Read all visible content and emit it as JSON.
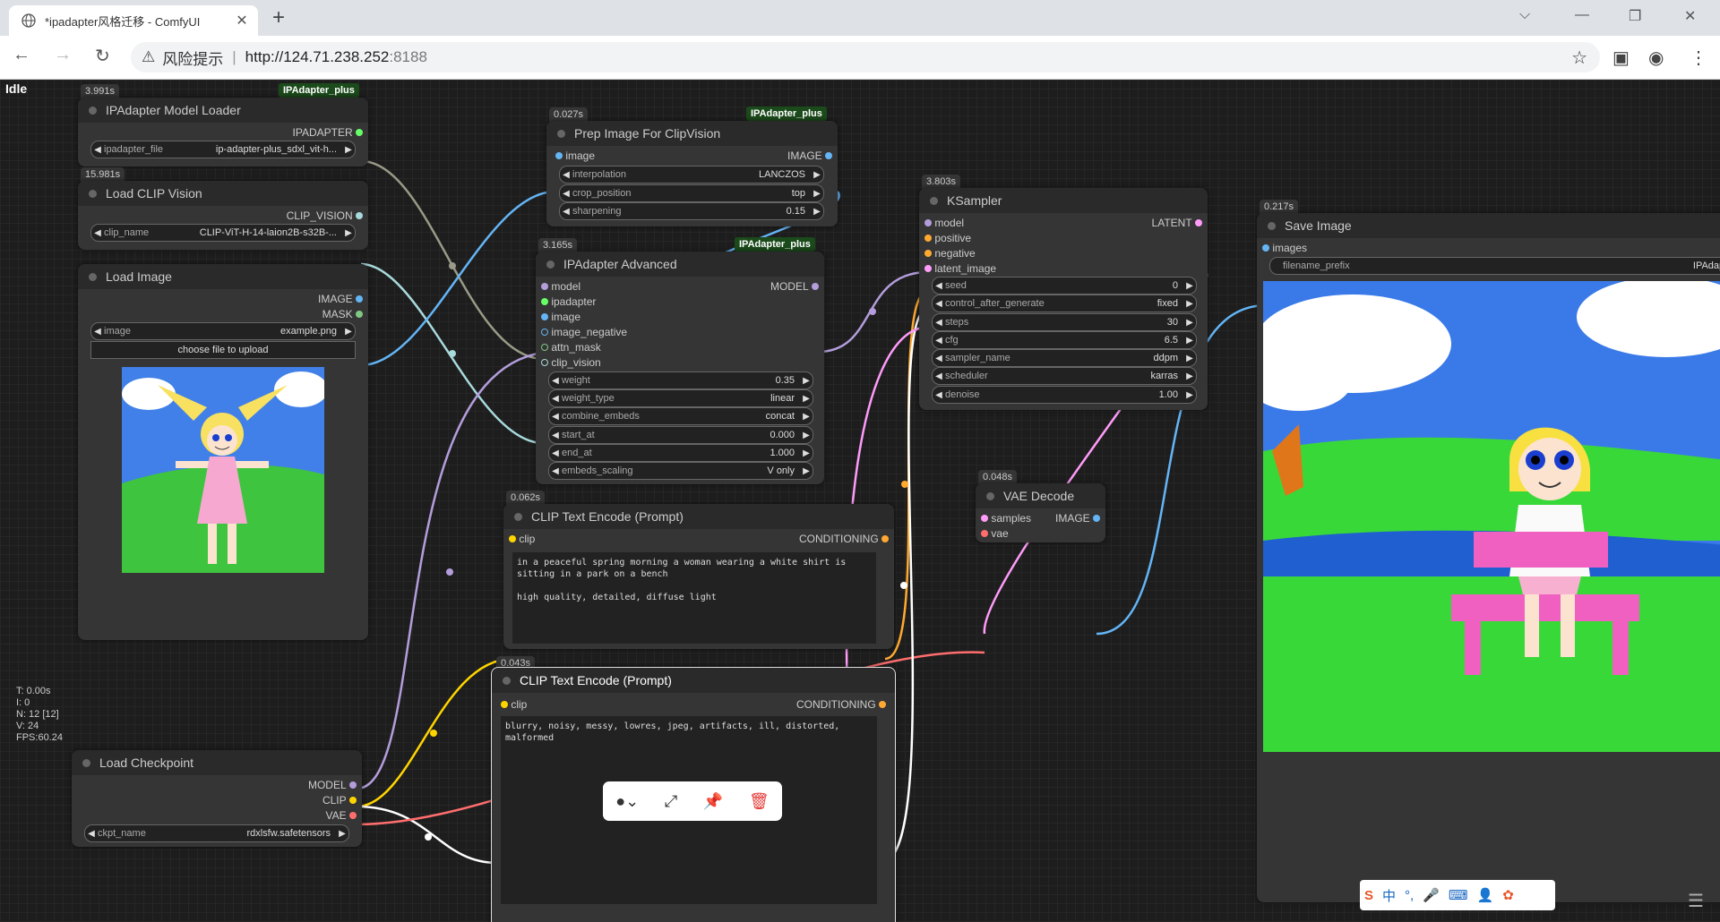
{
  "browser": {
    "tab_title": "*ipadapter风格迁移 - ComfyUI",
    "security_label": "风险提示",
    "url_host": "http://124.71.238.252",
    "url_port": ":8188"
  },
  "app": {
    "status": "Idle",
    "stats": [
      "T: 0.00s",
      "I: 0",
      "N: 12 [12]",
      "V: 24",
      "FPS:60.24"
    ]
  },
  "nodes": {
    "ipadapter_loader": {
      "time": "3.991s",
      "tag": "IPAdapter_plus",
      "title": "IPAdapter Model Loader",
      "output": "IPADAPTER",
      "widget_label": "ipadapter_file",
      "widget_value": "ip-adapter-plus_sdxl_vit-h..."
    },
    "clip_vision": {
      "time": "15.981s",
      "title": "Load CLIP Vision",
      "output": "CLIP_VISION",
      "widget_label": "clip_name",
      "widget_value": "CLIP-ViT-H-14-laion2B-s32B-..."
    },
    "load_image": {
      "title": "Load Image",
      "out1": "IMAGE",
      "out2": "MASK",
      "widget_label": "image",
      "widget_value": "example.png",
      "upload": "choose file to upload"
    },
    "prep_image": {
      "time": "0.027s",
      "tag": "IPAdapter_plus",
      "title": "Prep Image For ClipVision",
      "input": "image",
      "output": "IMAGE",
      "widgets": [
        {
          "label": "interpolation",
          "value": "LANCZOS"
        },
        {
          "label": "crop_position",
          "value": "top"
        },
        {
          "label": "sharpening",
          "value": "0.15"
        }
      ]
    },
    "ipadapter_adv": {
      "time": "3.165s",
      "tag": "IPAdapter_plus",
      "title": "IPAdapter Advanced",
      "output": "MODEL",
      "inputs": [
        "model",
        "ipadapter",
        "image",
        "image_negative",
        "attn_mask",
        "clip_vision"
      ],
      "widgets": [
        {
          "label": "weight",
          "value": "0.35"
        },
        {
          "label": "weight_type",
          "value": "linear"
        },
        {
          "label": "combine_embeds",
          "value": "concat"
        },
        {
          "label": "start_at",
          "value": "0.000"
        },
        {
          "label": "end_at",
          "value": "1.000"
        },
        {
          "label": "embeds_scaling",
          "value": "V only"
        }
      ]
    },
    "ksampler": {
      "time": "3.803s",
      "title": "KSampler",
      "output": "LATENT",
      "inputs": [
        "model",
        "positive",
        "negative",
        "latent_image"
      ],
      "widgets": [
        {
          "label": "seed",
          "value": "0"
        },
        {
          "label": "control_after_generate",
          "value": "fixed"
        },
        {
          "label": "steps",
          "value": "30"
        },
        {
          "label": "cfg",
          "value": "6.5"
        },
        {
          "label": "sampler_name",
          "value": "ddpm"
        },
        {
          "label": "scheduler",
          "value": "karras"
        },
        {
          "label": "denoise",
          "value": "1.00"
        }
      ]
    },
    "save_image": {
      "time": "0.217s",
      "title": "Save Image",
      "input": "images",
      "widget_label": "filename_prefix",
      "widget_value": "IPAdapter"
    },
    "vae_decode": {
      "time": "0.048s",
      "title": "VAE Decode",
      "in1": "samples",
      "in2": "vae",
      "output": "IMAGE"
    },
    "clip_pos": {
      "time": "0.062s",
      "title": "CLIP Text Encode (Prompt)",
      "input": "clip",
      "output": "CONDITIONING",
      "text": "in a peaceful spring morning a woman wearing a white shirt is sitting in a park on a bench\n\nhigh quality, detailed, diffuse light"
    },
    "clip_neg": {
      "time": "0.043s",
      "title": "CLIP Text Encode (Prompt)",
      "input": "clip",
      "output": "CONDITIONING",
      "text": "blurry, noisy, messy, lowres, jpeg, artifacts, ill, distorted, malformed"
    },
    "checkpoint": {
      "title": "Load Checkpoint",
      "out1": "MODEL",
      "out2": "CLIP",
      "out3": "VAE",
      "widget_label": "ckpt_name",
      "widget_value": "rdxlsfw.safetensors"
    }
  },
  "colors": {
    "model": "#b39ddb",
    "clip": "#ffd500",
    "vae": "#ff6e6e",
    "image": "#64b5f6",
    "latent": "#ff9cf9",
    "conditioning": "#ffa931",
    "ipadapter": "#66ff66",
    "clip_vision": "#a8dadc",
    "mask": "#81c784"
  }
}
